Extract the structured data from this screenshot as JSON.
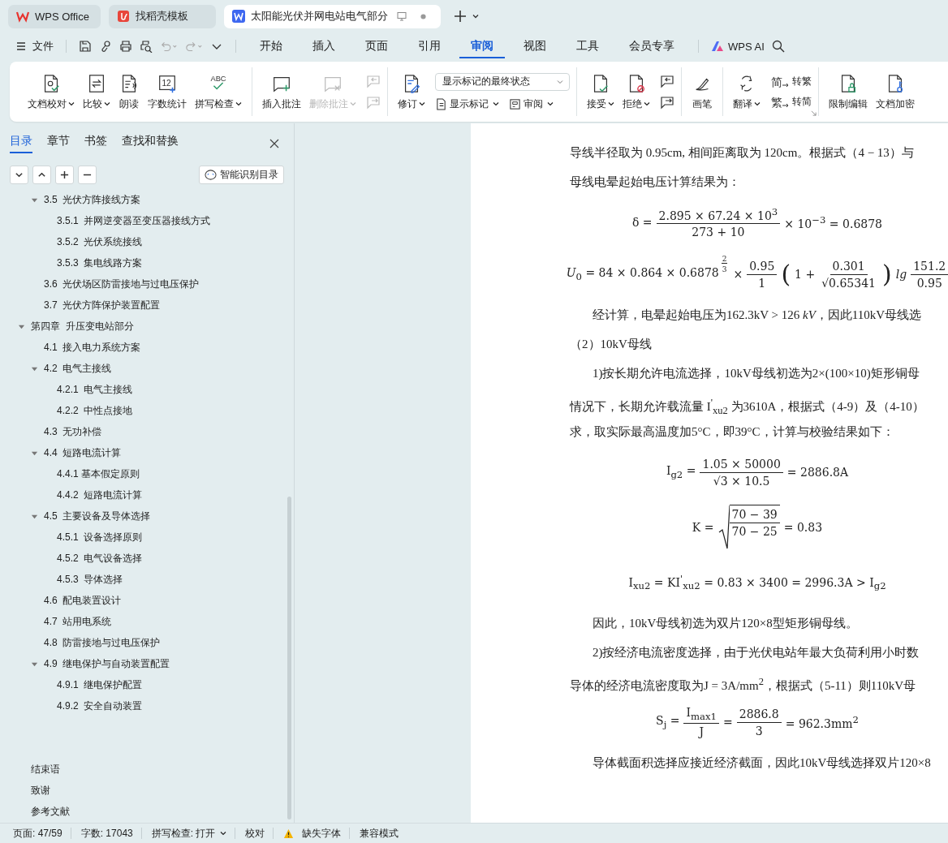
{
  "app_tabs": [
    {
      "label": "WPS Office",
      "selected": false
    },
    {
      "label": "找稻壳模板",
      "selected": false
    },
    {
      "label": "太阳能光伏并网电站电气部分",
      "selected": true
    }
  ],
  "menu": {
    "file": "文件",
    "tabs": [
      {
        "label": "开始",
        "selected": false
      },
      {
        "label": "插入",
        "selected": false
      },
      {
        "label": "页面",
        "selected": false
      },
      {
        "label": "引用",
        "selected": false
      },
      {
        "label": "审阅",
        "selected": true
      },
      {
        "label": "视图",
        "selected": false
      },
      {
        "label": "工具",
        "selected": false
      },
      {
        "label": "会员专享",
        "selected": false
      }
    ],
    "ai": "WPS AI"
  },
  "ribbon": [
    {
      "items": [
        {
          "kind": "big",
          "label": "文档校对",
          "dropdown": true,
          "disabled": false
        },
        {
          "kind": "big",
          "label": "比较",
          "dropdown": true,
          "disabled": false
        },
        {
          "kind": "big",
          "label": "朗读",
          "dropdown": false,
          "disabled": false
        },
        {
          "kind": "big",
          "label": "字数统计",
          "dropdown": false,
          "disabled": false,
          "icon_text": "12"
        },
        {
          "kind": "big",
          "label": "拼写检查",
          "dropdown": true,
          "disabled": false,
          "icon_text": "ABC"
        }
      ]
    },
    {
      "items": [
        {
          "kind": "big",
          "label": "插入批注",
          "dropdown": false,
          "disabled": false
        },
        {
          "kind": "big",
          "label": "删除批注",
          "dropdown": true,
          "disabled": true
        },
        {
          "kind": "column",
          "items": [
            {
              "kind": "icon",
              "disabled": true
            },
            {
              "kind": "icon",
              "disabled": true
            }
          ]
        }
      ]
    },
    {
      "items": [
        {
          "kind": "big",
          "label": "修订",
          "dropdown": true,
          "disabled": false
        },
        {
          "kind": "column",
          "items": [
            {
              "kind": "select",
              "value": "显示标记的最终状态"
            },
            {
              "kind": "pair",
              "buttons": [
                {
                  "label": "显示标记",
                  "dropdown": true
                },
                {
                  "label": "审阅",
                  "dropdown": true
                }
              ]
            }
          ]
        }
      ]
    },
    {
      "items": [
        {
          "kind": "big",
          "label": "接受",
          "dropdown": true,
          "disabled": false
        },
        {
          "kind": "big",
          "label": "拒绝",
          "dropdown": true,
          "disabled": false
        },
        {
          "kind": "column",
          "items": [
            {
              "kind": "icon",
              "disabled": false
            },
            {
              "kind": "icon",
              "disabled": false
            }
          ]
        }
      ]
    },
    {
      "items": [
        {
          "kind": "big",
          "label": "画笔",
          "dropdown": false,
          "disabled": false
        }
      ]
    },
    {
      "items": [
        {
          "kind": "big",
          "label": "翻译",
          "dropdown": true,
          "disabled": false
        },
        {
          "kind": "column",
          "items": [
            {
              "kind": "small",
              "label": "转繁",
              "icon_text": "简"
            },
            {
              "kind": "small",
              "label": "转简",
              "icon_text": "繁"
            }
          ]
        }
      ]
    },
    {
      "items": [
        {
          "kind": "big",
          "label": "限制编辑",
          "dropdown": false,
          "disabled": false
        },
        {
          "kind": "big",
          "label": "文档加密",
          "dropdown": false,
          "disabled": false
        }
      ]
    }
  ],
  "sidebar": {
    "tabs": [
      {
        "label": "目录",
        "selected": true
      },
      {
        "label": "章节",
        "selected": false
      },
      {
        "label": "书签",
        "selected": false
      },
      {
        "label": "查找和替换",
        "selected": false
      }
    ],
    "smart_button": "智能识别目录",
    "toc_continued": [
      {
        "label": "3.5  光伏方阵接线方案",
        "expanded": true,
        "children": [
          {
            "label": "3.5.1  并网逆变器至变压器接线方式"
          },
          {
            "label": "3.5.2  光伏系统接线"
          },
          {
            "label": "3.5.3  集电线路方案"
          }
        ]
      },
      {
        "label": "3.6  光伏场区防雷接地与过电压保护"
      },
      {
        "label": "3.7  光伏方阵保护装置配置"
      }
    ],
    "toc": [
      {
        "label": "第四章  升压变电站部分",
        "expanded": true,
        "children": [
          {
            "label": "4.1  接入电力系统方案"
          },
          {
            "label": "4.2  电气主接线",
            "expanded": true,
            "children": [
              {
                "label": "4.2.1  电气主接线"
              },
              {
                "label": "4.2.2  中性点接地"
              }
            ]
          },
          {
            "label": "4.3  无功补偿"
          },
          {
            "label": "4.4  短路电流计算",
            "expanded": true,
            "children": [
              {
                "label": "4.4.1 基本假定原则"
              },
              {
                "label": "4.4.2  短路电流计算"
              }
            ]
          },
          {
            "label": "4.5  主要设备及导体选择",
            "expanded": true,
            "children": [
              {
                "label": "4.5.1  设备选择原则"
              },
              {
                "label": "4.5.2  电气设备选择"
              },
              {
                "label": "4.5.3  导体选择"
              }
            ]
          },
          {
            "label": "4.6  配电装置设计"
          },
          {
            "label": "4.7  站用电系统"
          },
          {
            "label": "4.8  防雷接地与过电压保护"
          },
          {
            "label": "4.9  继电保护与自动装置配置",
            "expanded": true,
            "children": [
              {
                "label": "4.9.1  继电保护配置"
              },
              {
                "label": "4.9.2  安全自动装置"
              }
            ]
          }
        ]
      }
    ],
    "back_matter": [
      {
        "label": "结束语"
      },
      {
        "label": "致谢"
      },
      {
        "label": "参考文献"
      }
    ]
  },
  "document": [
    {
      "kind": "para",
      "indent": false,
      "text": "导线半径取为  0.95cm, 相间距离取为 120cm。根据式（4 − 13）与"
    },
    {
      "kind": "para",
      "indent": false,
      "text": "母线电晕起始电压计算结果为："
    },
    {
      "kind": "equation",
      "tokens": [
        {
          "kind": "text",
          "text": "δ ="
        },
        {
          "kind": "frac",
          "num": "2.895 × 67.24 × 10$^{3}$",
          "den": "273 + 10"
        },
        {
          "kind": "text",
          "text": "× 10$^{−3}$ =   0.6878"
        }
      ]
    },
    {
      "kind": "equation",
      "tokens": [
        {
          "kind": "text",
          "text": "*U*$_{0}$ = 84 × 0.864 × 0.6878"
        },
        {
          "kind": "supfrac",
          "num": "2",
          "den": "3"
        },
        {
          "kind": "text",
          "text": "×"
        },
        {
          "kind": "frac",
          "num": "0.95",
          "den": "1"
        },
        {
          "kind": "big",
          "text": "("
        },
        {
          "kind": "text",
          "text": "1 +"
        },
        {
          "kind": "frac",
          "num": "0.301",
          "den": "√0.65341"
        },
        {
          "kind": "big",
          "text": ")"
        },
        {
          "kind": "text",
          "text": "*lg*"
        },
        {
          "kind": "frac",
          "num": "151.2",
          "den": "0.95"
        }
      ]
    },
    {
      "kind": "para",
      "indent": true,
      "text": "经计算，电晕起始电压为162.3kV > 126 *kV*，因此110kV母线选"
    },
    {
      "kind": "para",
      "indent": false,
      "text": "（2）10kV母线"
    },
    {
      "kind": "para",
      "indent": true,
      "text": "1)按长期允许电流选择，10kV母线初选为2×(100×10)矩形铜母"
    },
    {
      "kind": "para",
      "indent": false,
      "text": "情况下，长期允许载流量 I$^{'}$$_{xu2}$ 为3610A，根据式（4-9）及（4-10）"
    },
    {
      "kind": "para",
      "indent": false,
      "text": "求，取实际最高温度加5°C，即39°C，计算与校验结果如下："
    },
    {
      "kind": "equation",
      "tokens": [
        {
          "kind": "text",
          "text": "I$_{g2}$ ="
        },
        {
          "kind": "frac",
          "num": "1.05 × 50000",
          "den": "√3 × 10.5"
        },
        {
          "kind": "text",
          "text": "= 2886.8A"
        }
      ]
    },
    {
      "kind": "equation",
      "tokens": [
        {
          "kind": "text",
          "text": "K ="
        },
        {
          "kind": "sqrtfrac",
          "num": "70 − 39",
          "den": "70 − 25"
        },
        {
          "kind": "text",
          "text": "= 0.83"
        }
      ]
    },
    {
      "kind": "equation",
      "tokens": [
        {
          "kind": "text",
          "text": "I$_{xu2}$ = KI$^{'}$$_{xu2}$ = 0.83 × 3400 = 2996.3A > I$_{g2}$"
        }
      ]
    },
    {
      "kind": "para",
      "indent": true,
      "text": "因此，10kV母线初选为双片120×8型矩形铜母线。"
    },
    {
      "kind": "para",
      "indent": true,
      "text": "2)按经济电流密度选择，由于光伏电站年最大负荷利用小时数"
    },
    {
      "kind": "para",
      "indent": false,
      "text": "导体的经济电流密度取为J = 3A/mm$^{2}$，根据式（5-11）则110kV母"
    },
    {
      "kind": "equation",
      "tokens": [
        {
          "kind": "text",
          "text": "S$_{j}$ ="
        },
        {
          "kind": "frac",
          "num": "I$_{max1}$",
          "den": "J"
        },
        {
          "kind": "text",
          "text": "="
        },
        {
          "kind": "frac",
          "num": "2886.8",
          "den": "3"
        },
        {
          "kind": "text",
          "text": "= 962.3mm$^{2}$"
        }
      ]
    },
    {
      "kind": "para",
      "indent": true,
      "text": "导体截面积选择应接近经济截面，因此10kV母线选择双片120×8"
    }
  ],
  "status_bar": [
    {
      "label": "页面: 47/59",
      "dropdown": false,
      "warning": false
    },
    {
      "label": "字数: 17043",
      "dropdown": false,
      "warning": false
    },
    {
      "label": "拼写检查: 打开",
      "dropdown": true,
      "warning": false
    },
    {
      "label": "校对",
      "dropdown": false,
      "warning": false
    },
    {
      "label": "缺失字体",
      "dropdown": false,
      "warning": true
    },
    {
      "label": "兼容模式",
      "dropdown": false,
      "warning": false
    }
  ]
}
